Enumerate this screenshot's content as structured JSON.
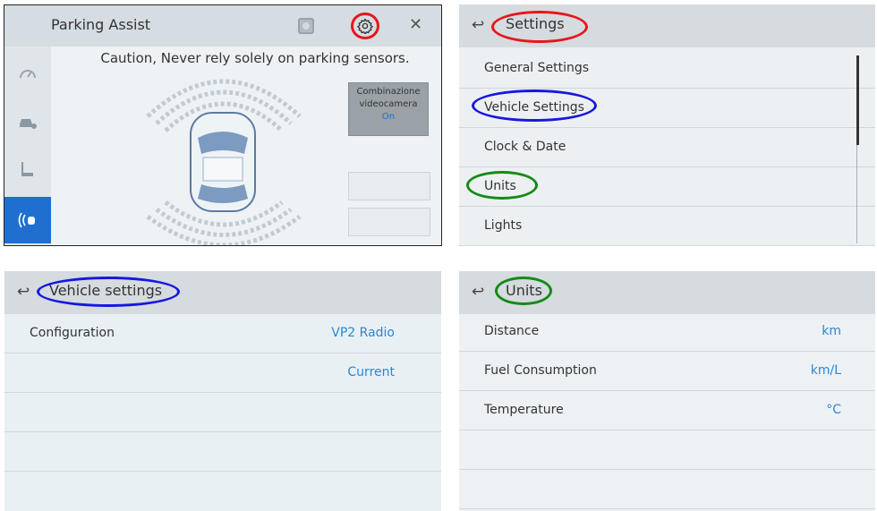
{
  "parking_assist": {
    "title": "Parking Assist",
    "caution": "Caution, Never rely solely on parking sensors.",
    "camera_combo": {
      "line1": "Combinazione",
      "line2": "videocamera",
      "state": "On"
    }
  },
  "settings": {
    "title": "Settings",
    "items": [
      {
        "label": "General Settings"
      },
      {
        "label": "Vehicle Settings"
      },
      {
        "label": "Clock & Date"
      },
      {
        "label": "Units"
      },
      {
        "label": "Lights"
      }
    ]
  },
  "vehicle_settings": {
    "title": "Vehicle settings",
    "rows": [
      {
        "label": "Configuration",
        "value": "VP2 Radio"
      },
      {
        "label": "",
        "value": "Current"
      }
    ]
  },
  "units": {
    "title": "Units",
    "rows": [
      {
        "label": "Distance",
        "value": "km"
      },
      {
        "label": "Fuel Consumption",
        "value": "km/L"
      },
      {
        "label": "Temperature",
        "value": "°C"
      }
    ]
  },
  "colors": {
    "highlight_red": "#e8151b",
    "highlight_blue": "#1717e0",
    "highlight_green": "#158a15",
    "accent_blue": "#1f6fd1",
    "value_blue": "#2a86d8"
  }
}
